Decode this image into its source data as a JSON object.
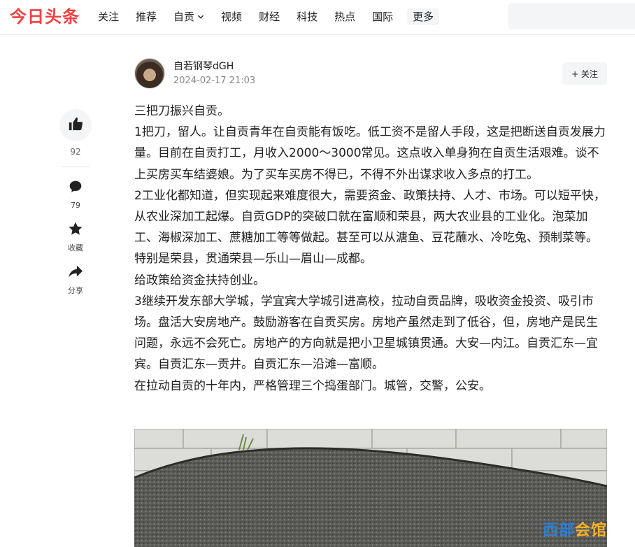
{
  "header": {
    "logo": "今日头条",
    "nav": [
      {
        "label": "关注",
        "dropdown": false
      },
      {
        "label": "推荐",
        "dropdown": false
      },
      {
        "label": "自贡",
        "dropdown": true
      },
      {
        "label": "视频",
        "dropdown": false
      },
      {
        "label": "财经",
        "dropdown": false
      },
      {
        "label": "科技",
        "dropdown": false
      },
      {
        "label": "热点",
        "dropdown": false
      },
      {
        "label": "国际",
        "dropdown": false
      }
    ],
    "more_label": "更多",
    "brand_color": "#f04142"
  },
  "sidebar": {
    "like_count": "92",
    "comment_count": "79",
    "favorite_label": "收藏",
    "share_label": "分享",
    "icons": [
      "thumbs-up-icon",
      "comment-icon",
      "star-icon",
      "share-icon"
    ]
  },
  "article": {
    "author_name": "自若钢琴dGH",
    "time": "2024-02-17 21:03",
    "follow_label": "+ 关注",
    "paragraphs": [
      "三把刀振兴自贡。",
      "1把刀，留人。让自贡青年在自贡能有饭吃。低工资不是留人手段，这是把断送自贡发展力量。目前在自贡打工，月收入2000～3000常见。这点收入单身狗在自贡生活艰难。谈不上买房买车结婆娘。为了买车买房不得已，不得不外出谋求收入多点的打工。",
      "2工业化都知道，但实现起来难度很大，需要资金、政策扶持、人才、市场。可以短平快，从农业深加工起爆。自贡GDP的突破口就在富顺和荣县，两大农业县的工业化。泡菜加工、海椒深加工、蔗糖加工等等做起。甚至可以从溏鱼、豆花蘸水、冷吃兔、预制菜等。特别是荣县，贯通荣县—乐山—眉山—成都。",
      "给政策给资金扶持创业。",
      "3继续开发东部大学城，学宜宾大学城引进高校，拉动自贡品牌，吸收资金投资、吸引市场。盘活大安房地产。鼓励游客在自贡买房。房地产虽然走到了低谷，但，房地产是民生问题，永远不会死亡。房地产的方向就是把小卫星城镇贯通。大安—内江。自贡汇东—宜宾。自贡汇东—贡井。自贡汇东—沿滩—富顺。",
      "在拉动自贡的十年内，严格管理三个捣蛋部门。城管，交警，公安。"
    ]
  },
  "watermark": {
    "part1": "西部",
    "part2": "会馆"
  }
}
